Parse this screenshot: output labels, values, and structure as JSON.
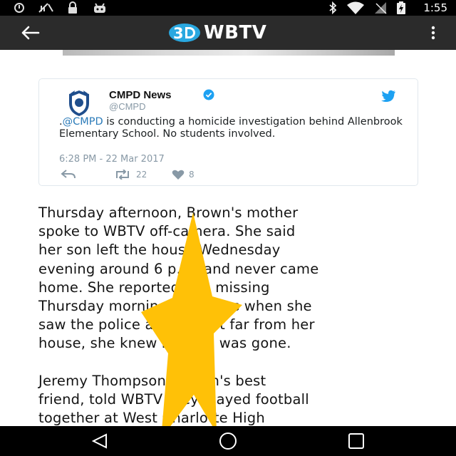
{
  "status_bar": {
    "time": "1:55",
    "left_icons": [
      "sync-icon",
      "data-off-icon",
      "lock-icon",
      "android-icon"
    ],
    "right_icons": [
      "bluetooth-icon",
      "wifi-icon",
      "signal-icon",
      "battery-charging-icon"
    ]
  },
  "app_bar": {
    "logo_badge": "3",
    "logo_text": "WBTV",
    "brand_color": "#29a8e0",
    "icons": [
      "back-arrow-icon",
      "overflow-menu-icon"
    ]
  },
  "tweet": {
    "name": "CMPD News",
    "handle": "@CMPD",
    "text_prefix": ".",
    "mention": "@CMPD",
    "text_rest": " is conducting a homicide investigation behind Allenbrook Elementary School. No students involved.",
    "timestamp": "6:28 PM - 22 Mar 2017",
    "retweets": "22",
    "likes": "8",
    "link_color": "#2b7bb9",
    "twitter_blue": "#1da1f2"
  },
  "article": {
    "lines_p1": [
      "Thursday afternoon, Brown's mother",
      "spoke to WBTV off-camera. She said",
      "her son left the house Wednesday",
      "evening around 6 p.m. and never came",
      "home. She reported him missing",
      "Thursday morning. She says when she",
      "saw the police activity not far from her",
      "house, she knew her son was gone."
    ],
    "lines_p2": [
      "Jeremy Thompson, Brown's best",
      "friend, told WBTV they played football",
      "together at West Charlotte High"
    ]
  },
  "overlay": {
    "shape": "star",
    "color": "#ffc107"
  },
  "nav_bar": {
    "icons": [
      "back-triangle-icon",
      "home-circle-icon",
      "recents-square-icon"
    ]
  }
}
